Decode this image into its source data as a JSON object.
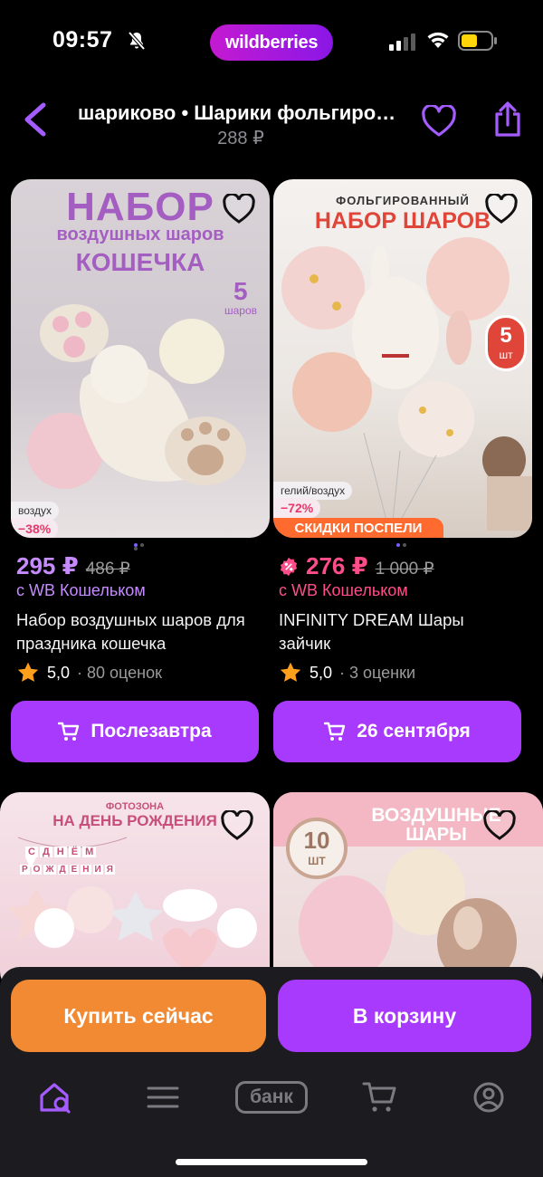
{
  "status_bar": {
    "time": "09:57",
    "app_badge": "wildberries"
  },
  "header": {
    "title": "шариково • Шарики фольгированные",
    "price": "288 ₽"
  },
  "products": [
    {
      "image": {
        "headline_1": "НАБОР",
        "headline_2": "воздушных шаров",
        "headline_3": "КОШЕЧКА",
        "count_num": "5",
        "count_word": "шаров",
        "tag": "воздух",
        "discount": "−38%"
      },
      "price": "295 ₽",
      "old_price": "486 ₽",
      "wallet": "с WB Кошельком",
      "name": "Набор воздушных шаров для праздника кошечка",
      "rating": "5,0",
      "reviews": "· 80 оценок",
      "button": "Послезавтра"
    },
    {
      "image": {
        "headline_1": "ФОЛЬГИРОВАННЫЙ",
        "headline_2": "НАБОР ШАРОВ",
        "count_num": "5",
        "count_word": "шт",
        "tag": "гелий/воздух",
        "discount": "−72%",
        "promo": "СКИДКИ ПОСПЕЛИ"
      },
      "price": "276 ₽",
      "old_price": "1 000 ₽",
      "wallet": "с WB Кошельком",
      "name": "INFINITY DREAM Шары зайчик",
      "rating": "5,0",
      "reviews": "· 3 оценки",
      "button": "26 сентября"
    },
    {
      "image": {
        "headline_1": "ФОТОЗОНА",
        "headline_2": "НА ДЕНЬ РОЖДЕНИЯ",
        "garland": [
          "С",
          "Д",
          "Н",
          "Ё",
          "М"
        ],
        "garland2": [
          "Р",
          "О",
          "Ж",
          "Д",
          "Е",
          "Н",
          "И",
          "Я"
        ]
      }
    },
    {
      "image": {
        "count_num": "10",
        "count_word": "ШТ",
        "headline_1": "ВОЗДУШНЫЕ",
        "headline_2": "ШАРЫ"
      }
    }
  ],
  "actions": {
    "buy_now": "Купить сейчас",
    "to_cart": "В корзину"
  },
  "tabbar": {
    "bank_label": "банк"
  },
  "colors": {
    "accent": "#a73afd",
    "orange": "#f28a33",
    "discount_pink": "#e8386a",
    "price_purple": "#c58bff",
    "price_pink": "#ff4d8a"
  }
}
